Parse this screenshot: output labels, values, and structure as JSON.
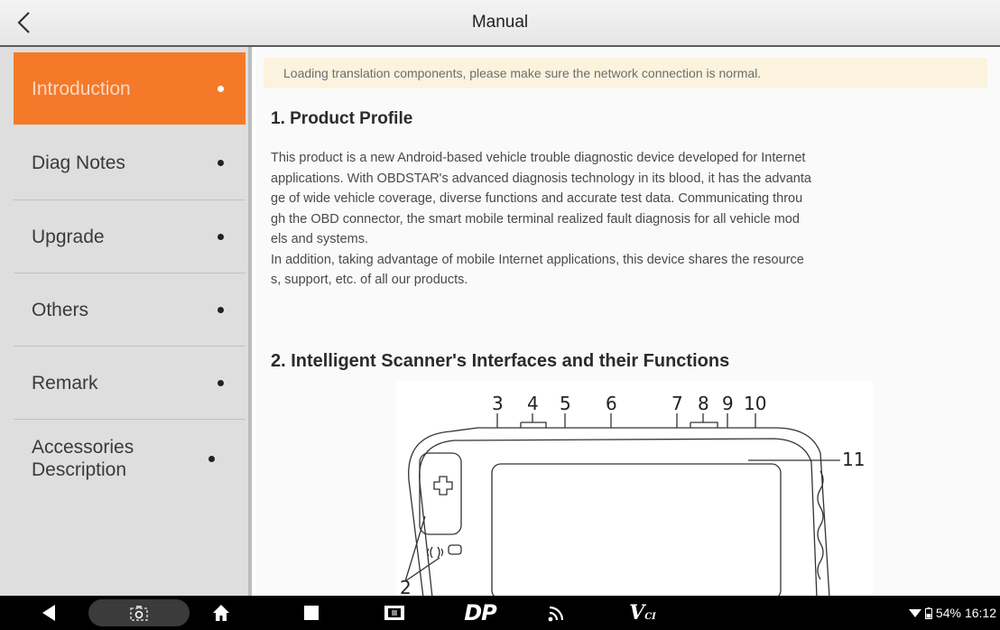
{
  "header": {
    "title": "Manual",
    "back_icon": "chevron-left-icon"
  },
  "sidebar": {
    "items": [
      {
        "label": "Introduction",
        "active": true
      },
      {
        "label": "Diag Notes",
        "active": false
      },
      {
        "label": "Upgrade",
        "active": false
      },
      {
        "label": "Others",
        "active": false
      },
      {
        "label": "Remark",
        "active": false
      },
      {
        "label": "Accessories Description",
        "active": false
      }
    ]
  },
  "content": {
    "notice": "Loading translation components, please make sure the network connection is normal.",
    "section1_title": "1. Product Profile",
    "section1_lines": [
      "This product is a new Android-based vehicle trouble diagnostic device developed for Internet",
      "applications. With OBDSTAR's advanced diagnosis technology in its blood, it has the advanta",
      "ge of wide vehicle coverage, diverse functions and accurate test data. Communicating throu",
      "gh the OBD connector, the smart mobile terminal realized fault diagnosis for all vehicle mod",
      "els and systems.",
      "In addition, taking advantage of mobile Internet applications, this device shares the resource",
      "s, support, etc. of all our products."
    ],
    "section2_title": "2. Intelligent Scanner's Interfaces and their Functions",
    "figure_labels": [
      "3",
      "4",
      "5",
      "6",
      "7",
      "8",
      "9",
      "10",
      "11",
      "2"
    ]
  },
  "navbar": {
    "buttons": [
      "back-icon",
      "screenshot-icon",
      "home-icon",
      "recents-icon",
      "gallery-icon",
      "dp-icon",
      "wifi-cast-icon",
      "vci-icon"
    ],
    "vci_label": "V",
    "vci_sub": "CI",
    "dp_label": "DP",
    "battery": "54%",
    "time": "16:12"
  },
  "colors": {
    "accent": "#f47a2a",
    "notice_bg": "#fbf3dd"
  }
}
